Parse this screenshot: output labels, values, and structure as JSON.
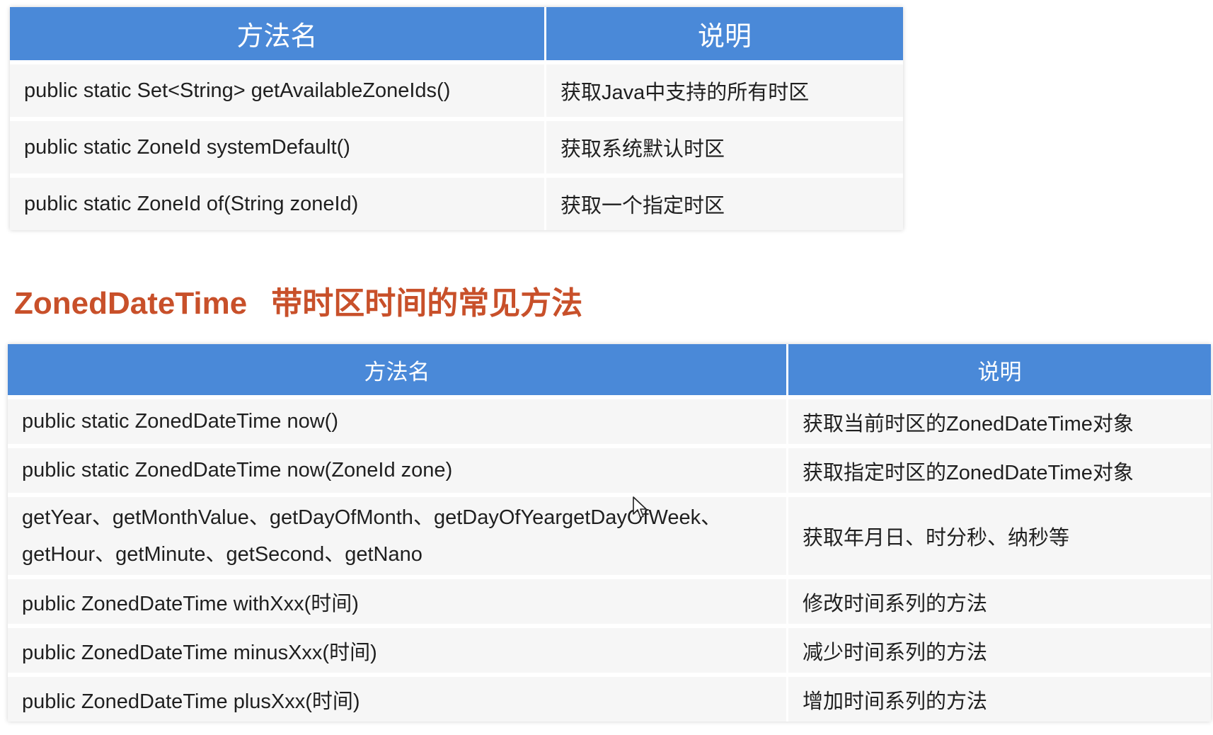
{
  "table1": {
    "headers": [
      "方法名",
      "说明"
    ],
    "rows": [
      {
        "method": "public static Set<String> getAvailableZoneIds()",
        "desc": "获取Java中支持的所有时区"
      },
      {
        "method": "public static ZoneId systemDefault()",
        "desc": "获取系统默认时区"
      },
      {
        "method": "public static ZoneId of(String zoneId)",
        "desc": "获取一个指定时区"
      }
    ]
  },
  "section": {
    "title_en": "ZonedDateTime",
    "title_cn": "带时区时间的常见方法"
  },
  "table2": {
    "headers": [
      "方法名",
      "说明"
    ],
    "rows": [
      {
        "method": "public static ZonedDateTime now()",
        "desc": "获取当前时区的ZonedDateTime对象"
      },
      {
        "method": "public static ZonedDateTime now(ZoneId zone)",
        "desc": "获取指定时区的ZonedDateTime对象"
      },
      {
        "method_line1": "getYear、getMonthValue、getDayOfMonth、getDayOfYeargetDayOfWeek、",
        "method_line2": "getHour、getMinute、getSecond、getNano",
        "desc": "获取年月日、时分秒、纳秒等"
      },
      {
        "method": "public ZonedDateTime withXxx(时间)",
        "desc": "修改时间系列的方法"
      },
      {
        "method": "public ZonedDateTime minusXxx(时间)",
        "desc": "减少时间系列的方法"
      },
      {
        "method": "public ZonedDateTime plusXxx(时间)",
        "desc": "增加时间系列的方法"
      }
    ]
  },
  "icons": {
    "cursor": "mouse-pointer-icon"
  }
}
